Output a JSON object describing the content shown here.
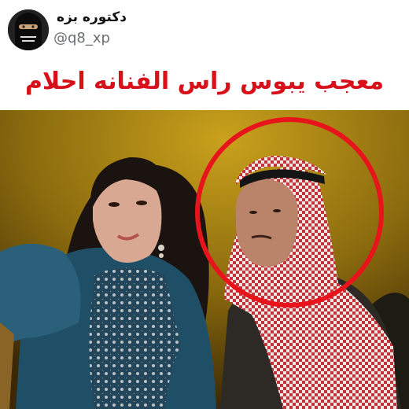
{
  "tweet": {
    "author": {
      "display_name": "دكتوره بزه",
      "handle": "@q8_xp",
      "avatar_icon": "niqab-avatar-icon"
    },
    "caption": "معجب يبوس راس الفنانه احلام",
    "caption_color": "#d8101a"
  },
  "media": {
    "type": "video-still",
    "highlight": {
      "shape": "circle",
      "color": "#e8141c",
      "target": "man-in-shemagh"
    }
  }
}
